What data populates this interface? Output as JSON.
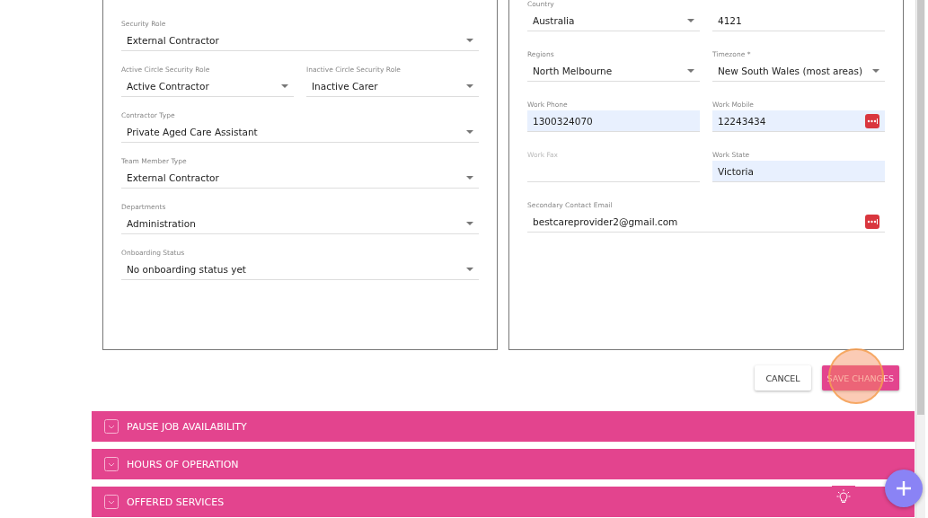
{
  "panels": [
    {
      "rows": [
        [
          {
            "label": "Security Role",
            "value": "External Contractor",
            "kind": "select",
            "autofilled": false,
            "manager_icon": false
          }
        ],
        [
          {
            "label": "Active Circle Security Role",
            "value": "Active Contractor",
            "kind": "select",
            "autofilled": false,
            "manager_icon": false
          },
          {
            "label": "Inactive Circle Security Role",
            "value": "Inactive Carer",
            "kind": "select",
            "autofilled": false,
            "manager_icon": false
          }
        ],
        [
          {
            "label": "Contractor Type",
            "value": "Private Aged Care Assistant",
            "kind": "select",
            "autofilled": false,
            "manager_icon": false
          }
        ],
        [
          {
            "label": "Team Member Type",
            "value": "External Contractor",
            "kind": "select",
            "autofilled": false,
            "manager_icon": false
          }
        ],
        [
          {
            "label": "Departments",
            "value": "Administration",
            "kind": "select",
            "autofilled": false,
            "manager_icon": false
          }
        ],
        [
          {
            "label": "Onboarding Status",
            "value": "No onboarding status yet",
            "kind": "select",
            "autofilled": false,
            "manager_icon": false
          }
        ]
      ]
    },
    {
      "rows": [
        [
          {
            "label": "Country",
            "value": "Australia",
            "kind": "select",
            "autofilled": false,
            "manager_icon": false
          },
          {
            "value": "4121",
            "kind": "input",
            "autofilled": false,
            "manager_icon": false
          }
        ],
        [
          {
            "label": "Regions",
            "value": "North Melbourne",
            "kind": "select",
            "autofilled": false,
            "manager_icon": false
          },
          {
            "label": "Timezone *",
            "value": "New South Wales (most areas)",
            "kind": "select",
            "autofilled": false,
            "manager_icon": false
          }
        ],
        [
          {
            "label": "Work Phone",
            "value": "1300324070",
            "kind": "input",
            "autofilled": true,
            "manager_icon": false
          },
          {
            "label": "Work Mobile",
            "value": "12243434",
            "kind": "input",
            "autofilled": true,
            "manager_icon": true
          }
        ],
        [
          {
            "label": "Work Fax",
            "kind": "input",
            "autofilled": false,
            "manager_icon": false
          },
          {
            "label": "Work State",
            "value": "Victoria",
            "kind": "input",
            "autofilled": true,
            "manager_icon": false
          }
        ],
        [
          {
            "label": "Secondary Contact Email",
            "value": "bestcareprovider2@gmail.com",
            "kind": "input",
            "autofilled": false,
            "manager_icon": true
          }
        ]
      ]
    }
  ],
  "buttons": [
    {
      "label": "CANCEL",
      "kind": "secondary"
    },
    {
      "label": "SAVE CHANGES",
      "kind": "primary"
    }
  ],
  "sections": [
    {
      "title": "PAUSE JOB AVAILABILITY",
      "expanded": false
    },
    {
      "title": "HOURS OF OPERATION",
      "expanded": false
    },
    {
      "title": "OFFERED SERVICES",
      "expanded": false
    }
  ]
}
